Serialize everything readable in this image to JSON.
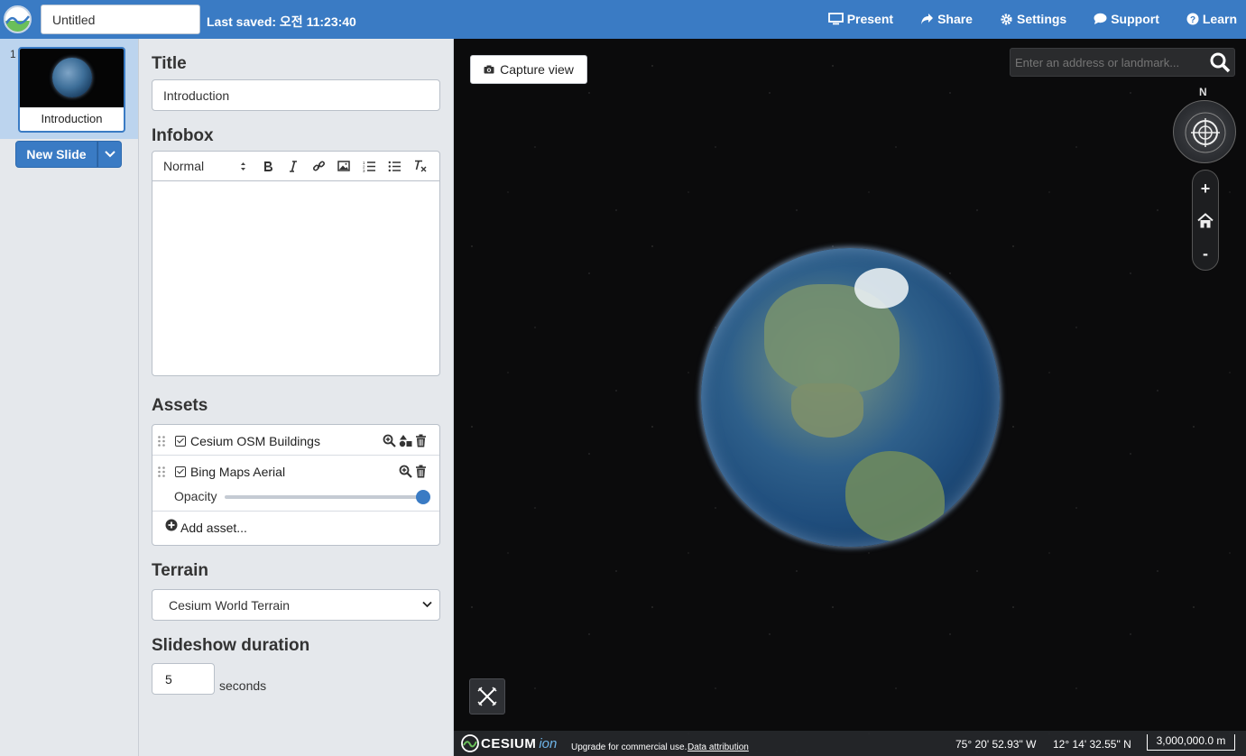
{
  "header": {
    "doc_title": "Untitled",
    "last_saved": "Last saved: 오전 11:23:40",
    "nav": [
      {
        "label": "Present",
        "icon": "monitor-icon"
      },
      {
        "label": "Share",
        "icon": "share-icon"
      },
      {
        "label": "Settings",
        "icon": "gear-icon"
      },
      {
        "label": "Support",
        "icon": "chat-bubble-icon"
      },
      {
        "label": "Learn",
        "icon": "question-circle-icon"
      }
    ]
  },
  "slides": {
    "items": [
      {
        "number": "1",
        "label": "Introduction"
      }
    ],
    "new_slide_label": "New Slide"
  },
  "editor": {
    "title_heading": "Title",
    "title_value": "Introduction",
    "infobox_heading": "Infobox",
    "format_value": "Normal",
    "assets_heading": "Assets",
    "assets": [
      {
        "name": "Cesium OSM Buildings",
        "checked": true
      },
      {
        "name": "Bing Maps Aerial",
        "checked": true,
        "opacity_label": "Opacity",
        "opacity": 1.0
      }
    ],
    "add_asset_label": "Add asset...",
    "terrain_heading": "Terrain",
    "terrain_value": "Cesium World Terrain",
    "duration_heading": "Slideshow duration",
    "duration_value": "5",
    "duration_unit": "seconds"
  },
  "viewer": {
    "capture_label": "Capture view",
    "search_placeholder": "Enter an address or landmark...",
    "compass_north": "N",
    "zoom_in": "+",
    "zoom_out": "-",
    "brand_word": "CESIUM",
    "brand_suffix": "ion",
    "upgrade_text": "Upgrade for commercial use.",
    "attribution_link": "Data attribution",
    "longitude": "75° 20' 52.93\" W",
    "latitude": "12° 14' 32.55\" N",
    "scale_label": "3,000,000.0 m"
  },
  "colors": {
    "accent": "#3a7bc4",
    "panel_bg": "#e5e8ec",
    "viewer_bg": "#0b0b0c"
  }
}
